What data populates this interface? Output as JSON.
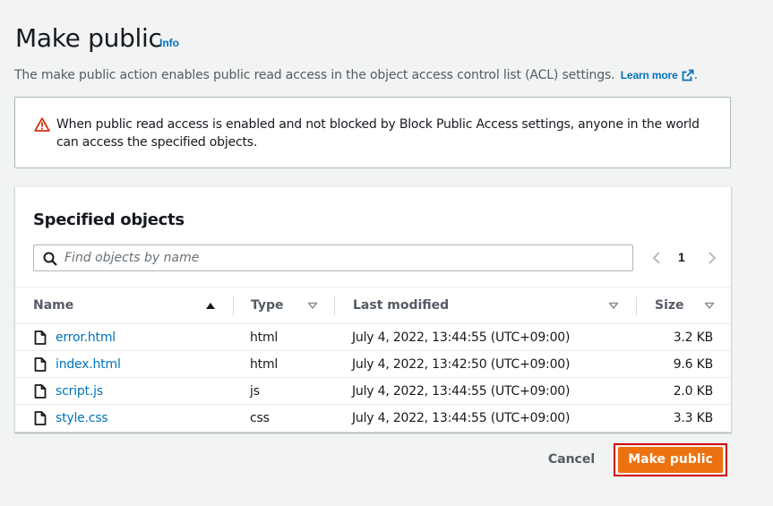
{
  "header": {
    "title": "Make public",
    "info_label": "Info",
    "description": "The make public action enables public read access in the object access control list (ACL) settings.",
    "learn_more_label": "Learn more",
    "description_suffix": "."
  },
  "alert": {
    "icon": "warning-icon",
    "text": "When public read access is enabled and not blocked by Block Public Access settings, anyone in the world can access the specified objects.",
    "icon_color": "#d13212"
  },
  "objects_panel": {
    "title": "Specified objects",
    "search_placeholder": "Find objects by name",
    "search_value": "",
    "current_page": "1",
    "columns": [
      "Name",
      "Type",
      "Last modified",
      "Size"
    ],
    "rows": [
      {
        "name": "error.html",
        "type": "html",
        "last_modified": "July 4, 2022, 13:44:55 (UTC+09:00)",
        "size": "3.2 KB"
      },
      {
        "name": "index.html",
        "type": "html",
        "last_modified": "July 4, 2022, 13:42:50 (UTC+09:00)",
        "size": "9.6 KB"
      },
      {
        "name": "script.js",
        "type": "js",
        "last_modified": "July 4, 2022, 13:44:55 (UTC+09:00)",
        "size": "2.0 KB"
      },
      {
        "name": "style.css",
        "type": "css",
        "last_modified": "July 4, 2022, 13:44:55 (UTC+09:00)",
        "size": "3.3 KB"
      }
    ]
  },
  "footer": {
    "cancel_label": "Cancel",
    "submit_label": "Make public",
    "submit_color": "#ec7211",
    "highlight_color": "#d00000"
  },
  "colors": {
    "link": "#0073bb",
    "background": "#f2f3f3"
  }
}
